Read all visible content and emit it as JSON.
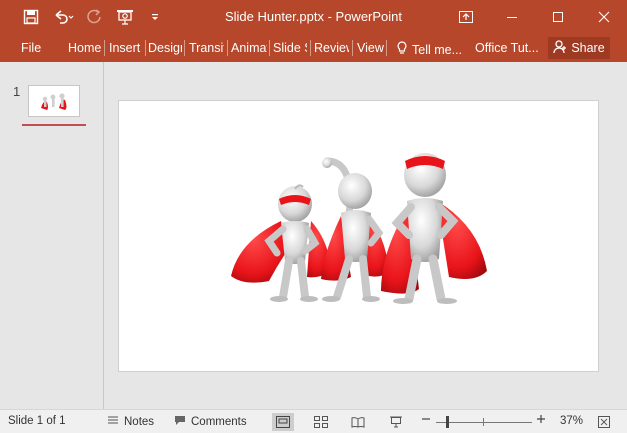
{
  "titlebar": {
    "title": "Slide Hunter.pptx - PowerPoint",
    "icons": [
      "save-icon",
      "undo-icon",
      "redo-icon",
      "start-from-beginning-icon",
      "customize-qat-icon"
    ],
    "window_icons": [
      "ribbon-display-options-icon",
      "minimize-icon",
      "maximize-icon",
      "close-icon"
    ]
  },
  "ribbon": {
    "file": "File",
    "tabs": [
      "Home",
      "Insert",
      "Design",
      "Transitions",
      "Animations",
      "Slide Show",
      "Review",
      "View"
    ],
    "tell_me": "Tell me...",
    "office_tut": "Office Tut...",
    "share": "Share"
  },
  "slides_pane": {
    "slide_number": "1"
  },
  "status": {
    "slide_info": "Slide 1 of 1",
    "notes": "Notes",
    "comments": "Comments",
    "zoom_level": "37%"
  },
  "colors": {
    "accent": "#b7472a",
    "share_bg": "#9e3a22",
    "cape_red": "#e8141a"
  }
}
